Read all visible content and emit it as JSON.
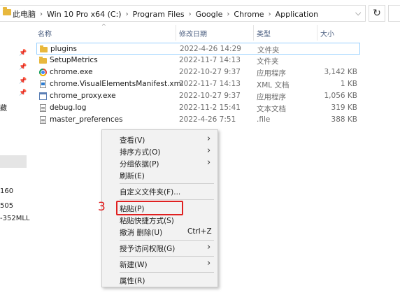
{
  "address": {
    "crumbs": [
      "此电脑",
      "Win 10 Pro x64 (C:)",
      "Program Files",
      "Google",
      "Chrome",
      "Application"
    ],
    "dropdown_icon": "chevron-down-icon",
    "refresh_icon": "refresh-icon"
  },
  "columns": {
    "name": "名称",
    "date": "修改日期",
    "type": "类型",
    "size": "大小"
  },
  "files": [
    {
      "icon": "folder",
      "name": "plugins",
      "date": "2022-4-26 14:29",
      "type": "文件夹",
      "size": ""
    },
    {
      "icon": "folder",
      "name": "SetupMetrics",
      "date": "2022-11-7 14:13",
      "type": "文件夹",
      "size": ""
    },
    {
      "icon": "chrome",
      "name": "chrome.exe",
      "date": "2022-10-27 9:37",
      "type": "应用程序",
      "size": "3,142 KB"
    },
    {
      "icon": "xml",
      "name": "chrome.VisualElementsManifest.xml",
      "date": "2022-11-7 14:13",
      "type": "XML 文档",
      "size": "1 KB"
    },
    {
      "icon": "exe",
      "name": "chrome_proxy.exe",
      "date": "2022-10-27 9:37",
      "type": "应用程序",
      "size": "1,056 KB"
    },
    {
      "icon": "doc",
      "name": "debug.log",
      "date": "2022-11-2 15:41",
      "type": "文本文档",
      "size": "319 KB"
    },
    {
      "icon": "doc",
      "name": "master_preferences",
      "date": "2022-4-26 7:51",
      "type": ".file",
      "size": "388 KB"
    }
  ],
  "nav_fragments": [
    "藏",
    "160",
    "505",
    "-352MLL"
  ],
  "context_menu": {
    "view": "查看(V)",
    "sort": "排序方式(O)",
    "group": "分组依据(P)",
    "refresh": "刷新(E)",
    "customize": "自定义文件夹(F)...",
    "paste": "粘贴(P)",
    "paste_shortcut": "粘贴快捷方式(S)",
    "undo_delete": "撤消 删除(U)",
    "undo_shortcut": "Ctrl+Z",
    "grant_access": "授予访问权限(G)",
    "new": "新建(W)",
    "properties": "属性(R)"
  },
  "annotation": {
    "step_number": "3",
    "color": "#e02020"
  }
}
